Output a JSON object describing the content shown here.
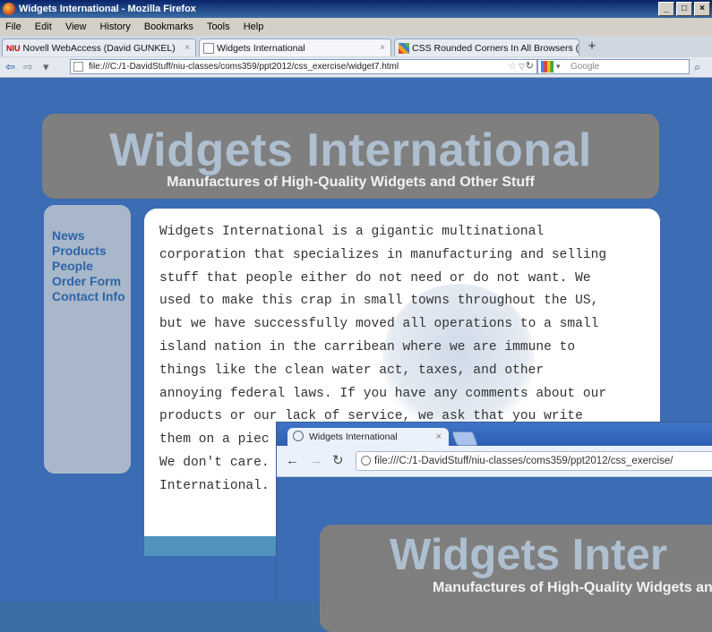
{
  "window": {
    "title": "Widgets International - Mozilla Firefox",
    "controls": [
      "_",
      "□",
      "×"
    ]
  },
  "menu": [
    "File",
    "Edit",
    "View",
    "History",
    "Bookmarks",
    "Tools",
    "Help"
  ],
  "tabs": [
    {
      "label": "Novell WebAccess (David GUNKEL)",
      "badge": "NIU",
      "close": "×"
    },
    {
      "label": "Widgets International",
      "close": "×"
    },
    {
      "label": "CSS Rounded Corners In All Browsers (W...",
      "close": "×"
    }
  ],
  "newtab_label": "+",
  "navbar": {
    "url": "file:///C:/1-DavidStuff/niu-classes/coms359/ppt2012/css_exercise/widget7.html",
    "search_placeholder": "Google"
  },
  "page": {
    "title": "Widgets International",
    "subtitle": "Manufactures of High-Quality Widgets and Other Stuff",
    "nav": [
      "News",
      "Products",
      "People",
      "Order Form",
      "Contact Info"
    ],
    "body_lines": [
      "Widgets International is a gigantic multinational",
      "corporation that specializes in manufacturing and selling",
      "stuff that people either do not need or do not want. We",
      "used to make this crap in small towns throughout the US,",
      "but we have successfully moved all operations to a small",
      "island nation in the carribean where we are immune to",
      "things like the clean water act, taxes, and other",
      "annoying federal laws. If you have any comments about our",
      "products or our lack of service, we ask that you write",
      "them on a piec",
      "We don't care.",
      "International."
    ]
  },
  "chrome": {
    "tab_label": "Widgets International",
    "tab_close": "×",
    "url": "file:///C:/1-DavidStuff/niu-classes/coms359/ppt2012/css_exercise/",
    "page_title": "Widgets Inter",
    "page_subtitle": "Manufactures of High-Quality Widgets and Other Stuff"
  }
}
